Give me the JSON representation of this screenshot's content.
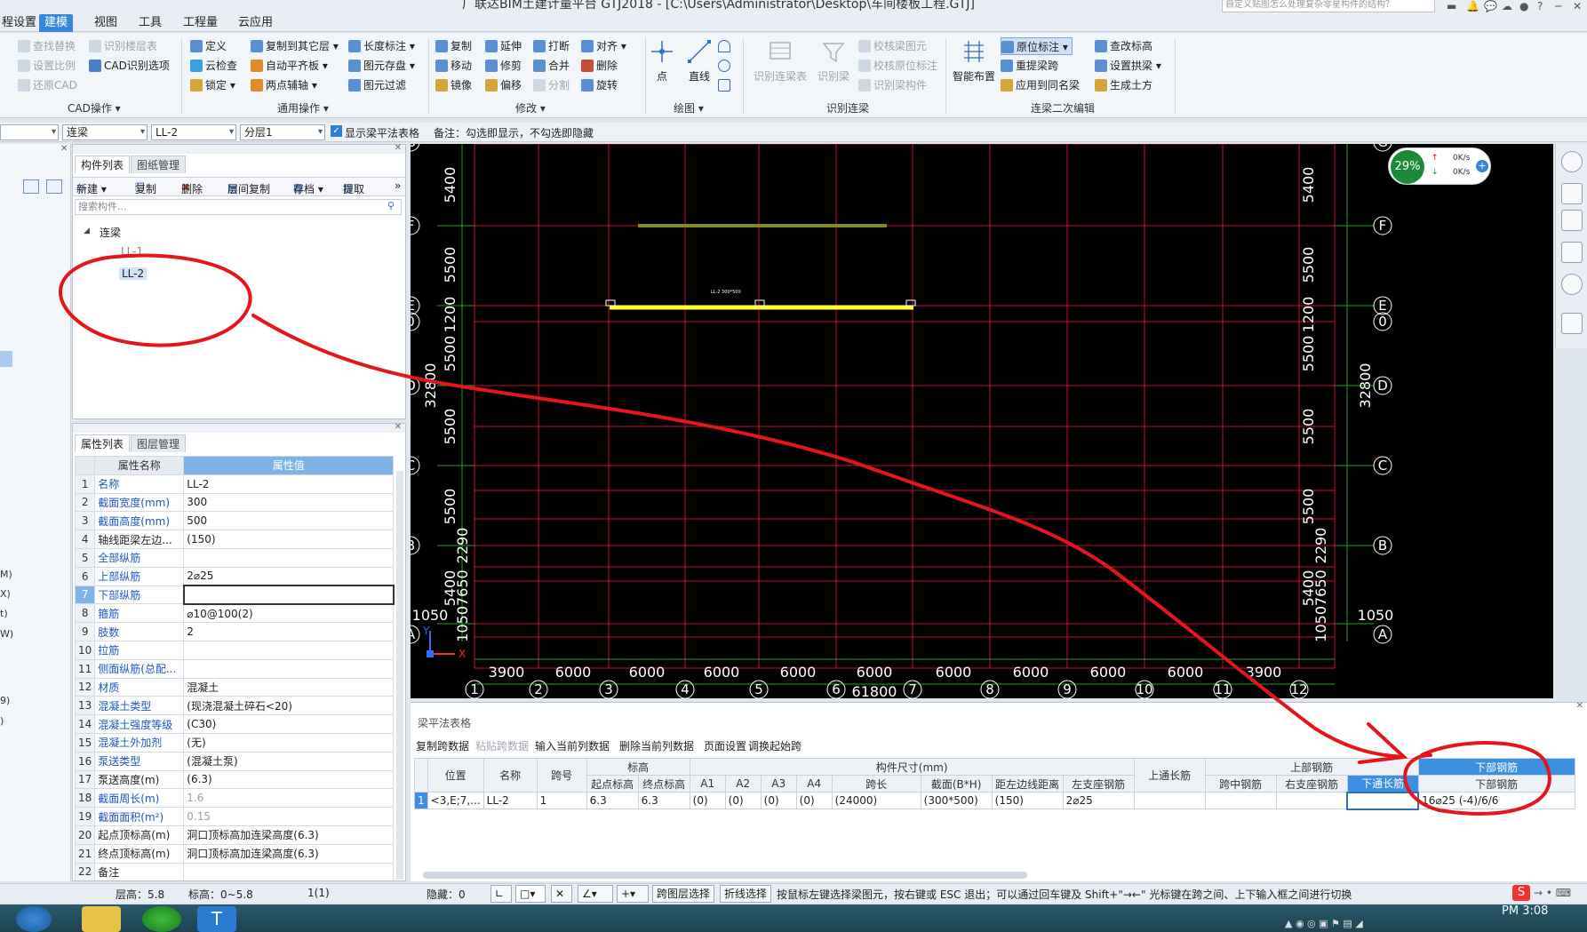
{
  "titlebar": {
    "title": "广联达BIM土建计量平台 GTJ2018 - [C:\\Users\\Administrator\\Desktop\\车间楼板工程.GTJ]",
    "help_search_placeholder": "自定义贴图怎么处理复杂零星构件的结构？"
  },
  "menu": {
    "items": [
      "程设置",
      "建模",
      "视图",
      "工具",
      "工程量",
      "云应用"
    ],
    "active": "建模"
  },
  "ribbon": {
    "cad_ops": {
      "label": "CAD操作 ▾",
      "items": [
        "查找替换",
        "识别楼层表",
        "设置比例",
        "CAD识别选项",
        "还原CAD"
      ]
    },
    "general_ops": {
      "label": "通用操作 ▾",
      "items": [
        "定义",
        "复制到其它层 ▾",
        "长度标注 ▾",
        "云检查",
        "自动平齐板 ▾",
        "图元存盘 ▾",
        "锁定 ▾",
        "两点辅轴 ▾",
        "图元过滤"
      ]
    },
    "modify": {
      "label": "修改 ▾",
      "items": [
        "复制",
        "延伸",
        "打断",
        "对齐 ▾",
        "移动",
        "修剪",
        "合并",
        "删除",
        "镜像",
        "偏移",
        "分割",
        "旋转"
      ]
    },
    "draw": {
      "label": "绘图 ▾",
      "items": [
        "点",
        "直线"
      ]
    },
    "recognize": {
      "label": "识别连梁",
      "items": [
        "识别连梁表",
        "识别梁",
        "校核梁图元",
        "校核原位标注",
        "识别梁构件"
      ]
    },
    "secondary_edit": {
      "label": "连梁二次编辑",
      "items": [
        "智能布置",
        "原位标注 ▾",
        "重提梁跨",
        "应用到同名梁",
        "查改标高",
        "设置拱梁 ▾",
        "生成土方"
      ]
    }
  },
  "filterbar": {
    "floor": "",
    "type": "连梁",
    "component": "LL-2",
    "layer": "分层1",
    "checkbox_label": "显示梁平法表格",
    "note": "备注：勾选即显示，不勾选即隐藏"
  },
  "left_strip": {
    "labels": [
      "M)",
      "X)",
      "t)",
      "W)",
      "9)",
      ")"
    ]
  },
  "component_panel": {
    "tabs": [
      "构件列表",
      "图纸管理"
    ],
    "toolbar": [
      "新建 ▾",
      "复制",
      "删除",
      "层间复制",
      "存档 ▾",
      "提取",
      "»"
    ],
    "search_placeholder": "搜索构件...",
    "tree_root": "连梁",
    "tree_items": [
      "LL-1",
      "LL-2"
    ]
  },
  "property_panel": {
    "tabs": [
      "属性列表",
      "图层管理"
    ],
    "headers": [
      "属性名称",
      "属性值"
    ],
    "rows": [
      {
        "n": "1",
        "name": "名称",
        "value": "LL-2"
      },
      {
        "n": "2",
        "name": "截面宽度(mm)",
        "value": "300"
      },
      {
        "n": "3",
        "name": "截面高度(mm)",
        "value": "500"
      },
      {
        "n": "4",
        "name": "轴线距梁左边...",
        "value": "(150)"
      },
      {
        "n": "5",
        "name": "全部纵筋",
        "value": ""
      },
      {
        "n": "6",
        "name": "上部纵筋",
        "value": "2⌀25"
      },
      {
        "n": "7",
        "name": "下部纵筋",
        "value": ""
      },
      {
        "n": "8",
        "name": "箍筋",
        "value": "⌀10@100(2)"
      },
      {
        "n": "9",
        "name": "肢数",
        "value": "2"
      },
      {
        "n": "10",
        "name": "拉筋",
        "value": ""
      },
      {
        "n": "11",
        "name": "侧面纵筋(总配...",
        "value": ""
      },
      {
        "n": "12",
        "name": "材质",
        "value": "混凝土"
      },
      {
        "n": "13",
        "name": "混凝土类型",
        "value": "(现浇混凝土碎石<20)"
      },
      {
        "n": "14",
        "name": "混凝土强度等级",
        "value": "(C30)"
      },
      {
        "n": "15",
        "name": "混凝土外加剂",
        "value": "(无)"
      },
      {
        "n": "16",
        "name": "泵送类型",
        "value": "(混凝土泵)"
      },
      {
        "n": "17",
        "name": "泵送高度(m)",
        "value": "(6.3)"
      },
      {
        "n": "18",
        "name": "截面周长(m)",
        "value": "1.6"
      },
      {
        "n": "19",
        "name": "截面面积(m²)",
        "value": "0.15"
      },
      {
        "n": "20",
        "name": "起点顶标高(m)",
        "value": "洞口顶标高加连梁高度(6.3)"
      },
      {
        "n": "21",
        "name": "终点顶标高(m)",
        "value": "洞口顶标高加连梁高度(6.3)"
      },
      {
        "n": "22",
        "name": "备注",
        "value": ""
      }
    ]
  },
  "canvas": {
    "axes_left": [
      "G",
      "F",
      "E",
      "0",
      "D",
      "C",
      "B",
      "A"
    ],
    "axes_bottom": [
      "1",
      "2",
      "3",
      "4",
      "5",
      "6",
      "7",
      "8",
      "9",
      "10",
      "11",
      "12"
    ],
    "bottom_dims": [
      "3900",
      "6000",
      "6000",
      "6000",
      "6000",
      "6000",
      "6000",
      "6000",
      "6000",
      "6000",
      "3900"
    ],
    "total_x": "61800",
    "left_dims": [
      "5400",
      "5500",
      "1200",
      "5500",
      "5500",
      "5500",
      "2290",
      "5400",
      "10507650"
    ],
    "right_dims": [
      "5400",
      "5500",
      "1200",
      "5500",
      "5500",
      "5500",
      "2290",
      "5400",
      "10507650"
    ],
    "total_y": "32800",
    "side_value": "1050",
    "beam_label": "LL-2 300*500",
    "zoom_percent": "29%",
    "net_up": "0K/s",
    "net_down": "0K/s",
    "x_axis_label": "X",
    "y_axis_label": "Y"
  },
  "beam_table": {
    "title": "梁平法表格",
    "toolbar": [
      "复制跨数据",
      "粘贴跨数据",
      "输入当前列数据",
      "删除当前列数据",
      "页面设置",
      "调换起始跨"
    ],
    "toolbar_disabled": [
      "粘贴跨数据"
    ],
    "group_headers": [
      "标高",
      "构件尺寸(mm)",
      "上部钢筋",
      "下部钢筋"
    ],
    "headers": [
      "位置",
      "名称",
      "跨号",
      "起点标高",
      "终点标高",
      "A1",
      "A2",
      "A3",
      "A4",
      "跨长",
      "截面(B*H)",
      "距左边线距离",
      "上通长筋",
      "左支座钢筋",
      "跨中钢筋",
      "右支座钢筋",
      "下通长筋",
      "下部钢筋"
    ],
    "row": {
      "idx": "1",
      "position": "<3,E;7,...",
      "name": "LL-2",
      "span": "1",
      "start_elev": "6.3",
      "end_elev": "6.3",
      "a1": "(0)",
      "a2": "(0)",
      "a3": "(0)",
      "a4": "(0)",
      "span_len": "(24000)",
      "section": "(300*500)",
      "offset": "(150)",
      "top_through": "2⌀25",
      "left_support": "",
      "mid_span": "",
      "right_support": "",
      "bottom_through": "",
      "bottom_rebar": "16⌀25 (-4)/6/6"
    }
  },
  "statusbar": {
    "floor_height": "层高：5.8",
    "elevation": "标高：0~5.8",
    "count": "1(1)",
    "hidden": "隐藏：0",
    "btn_span_layer": "跨图层选择",
    "btn_polyline": "折线选择",
    "hint": "按鼠标左键选择梁图元，按右键或 ESC 退出；可以通过回车键及 Shift+\"→←\" 光标键在跨之间、上下输入框之间进行切换"
  },
  "taskbar": {
    "clock": "PM 3:08"
  },
  "colors": {
    "accent": "#3b86d6",
    "canvas_bg": "#000000",
    "grid_red": "#c8102e",
    "grid_green": "#1fa02a",
    "beam_yellow": "#ffff33",
    "annotation_red": "#e4161b"
  }
}
